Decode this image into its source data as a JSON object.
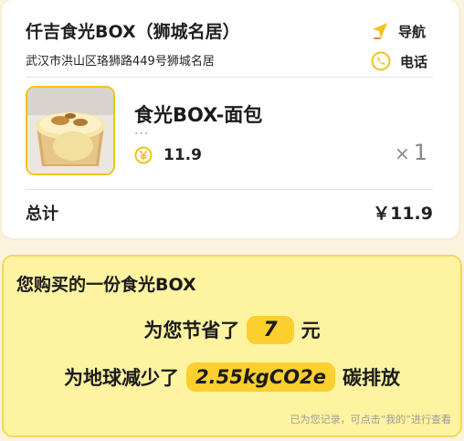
{
  "store": {
    "name": "仟吉食光BOX（狮城名居）",
    "address": "武汉市洪山区珞狮路449号狮城名居"
  },
  "actions": {
    "navigate_label": "导航",
    "call_label": "电话"
  },
  "product": {
    "name": "食光BOX-面包",
    "dots": "···",
    "price": "11.9",
    "quantity_symbol": "×",
    "quantity": "1"
  },
  "total": {
    "label": "总计",
    "value": "￥11.9"
  },
  "eco": {
    "title": "您购买的一份食光BOX",
    "saving_prefix": "为您节省了",
    "saving_value": "7",
    "saving_suffix": "元",
    "carbon_prefix": "为地球减少了",
    "carbon_value": "2.55kgCO2e",
    "carbon_suffix": "碳排放",
    "footnote": "已为您记录，可点击“我的”进行查看"
  },
  "colors": {
    "accent": "#f3c21a",
    "eco_background": "#fdf3a0",
    "pill": "#fbcf2e",
    "page_background": "#fbf3de"
  },
  "icons": {
    "navigate": "location-arrow-icon",
    "call": "phone-icon",
    "price": "yen-coin-icon"
  }
}
